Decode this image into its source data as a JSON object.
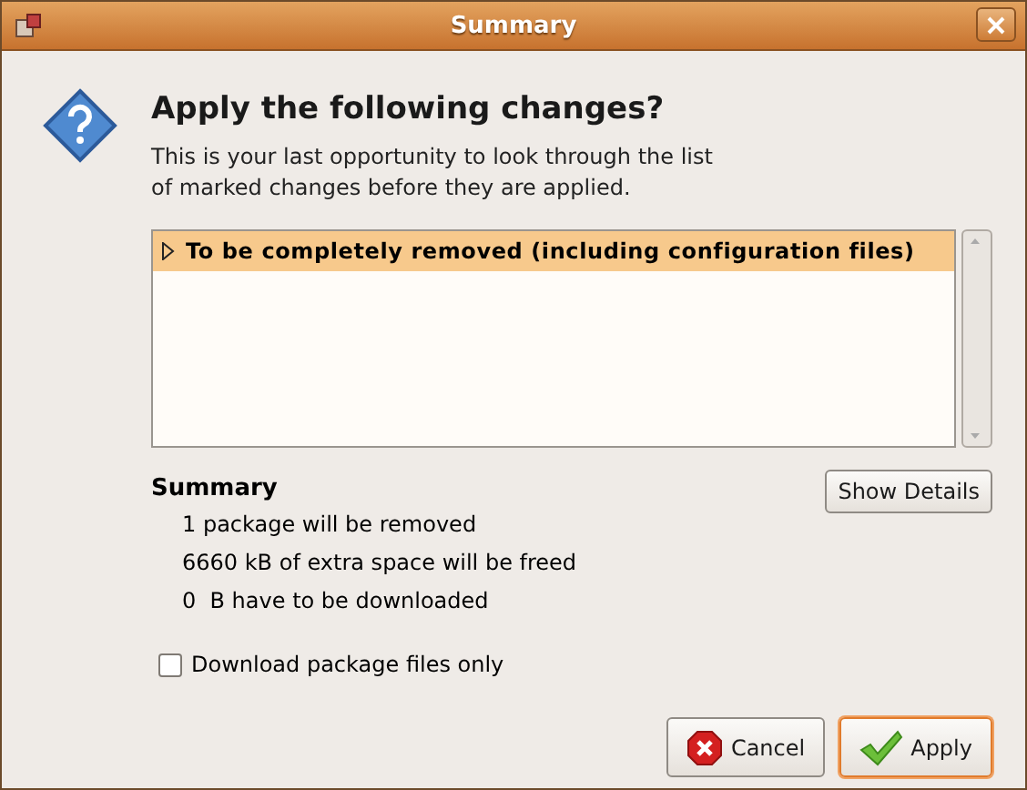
{
  "window": {
    "title": "Summary"
  },
  "heading": "Apply the following changes?",
  "description": "This is your last opportunity to look through the list of marked changes before they are applied.",
  "changes": [
    {
      "label": "To be completely removed (including configuration files)",
      "expanded": false,
      "selected": true
    }
  ],
  "summary": {
    "title": "Summary",
    "lines": [
      "1 package will be removed",
      "6660 kB of extra space will be freed",
      "0  B have to be downloaded"
    ]
  },
  "show_details_button": "Show Details",
  "download_only": {
    "label": "Download package files only",
    "checked": false
  },
  "buttons": [
    {
      "kind": "cancel",
      "label": "Cancel",
      "default": false
    },
    {
      "kind": "apply",
      "label": "Apply",
      "default": true
    }
  ]
}
